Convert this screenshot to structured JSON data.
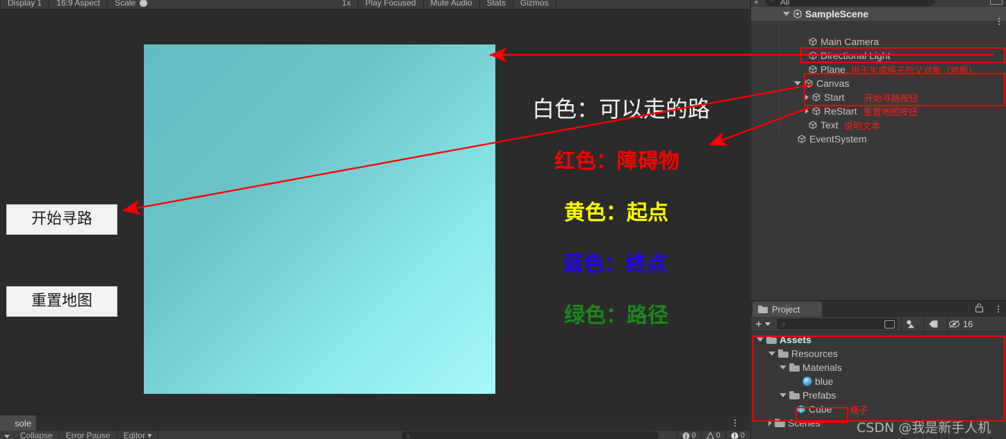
{
  "game_view": {
    "toolbar": {
      "display": "Display 1",
      "aspect": "16:9 Aspect",
      "scale_label": "Scale",
      "scale_value": "1x",
      "play_focused": "Play Focused",
      "mute_audio": "Mute Audio",
      "stats": "Stats",
      "gizmos": "Gizmos"
    },
    "buttons": {
      "start": "开始寻路",
      "reset": "重置地图"
    },
    "legend": [
      {
        "text": "白色：可以走的路",
        "color": "#f4f4f4"
      },
      {
        "text": "红色：障碍物",
        "color": "#ff0000"
      },
      {
        "text": "黄色：起点",
        "color": "#ffff00"
      },
      {
        "text": "蓝色：终点",
        "color": "#2200ff"
      },
      {
        "text": "绿色：路径",
        "color": "#1a8a1a"
      }
    ],
    "plane": {
      "color_top_left": "#62bcc2",
      "color_bottom_right": "#a6f8f7"
    }
  },
  "hierarchy": {
    "search_placeholder": "All",
    "scene": "SampleScene",
    "items": [
      {
        "label": "Main Camera",
        "note": ""
      },
      {
        "label": "Directional Light",
        "note": ""
      },
      {
        "label": "Plane",
        "note": "用于生成格子的父对象（地板）"
      },
      {
        "label": "Canvas",
        "note": ""
      },
      {
        "label": "Start",
        "note": "开始寻路按钮"
      },
      {
        "label": "ReStart",
        "note": "重置地图按钮"
      },
      {
        "label": "Text",
        "note": "说明文本"
      },
      {
        "label": "EventSystem",
        "note": ""
      }
    ]
  },
  "project": {
    "tab": "Project",
    "toolbar": {
      "add_label": "+",
      "search_placeholder": "",
      "visible_count": "16"
    },
    "tree": [
      {
        "label": "Assets",
        "note": ""
      },
      {
        "label": "Resources",
        "note": ""
      },
      {
        "label": "Materials",
        "note": ""
      },
      {
        "label": "blue",
        "note": ""
      },
      {
        "label": "Prefabs",
        "note": ""
      },
      {
        "label": "Cube",
        "note": "格子"
      },
      {
        "label": "Scenes",
        "note": ""
      }
    ]
  },
  "console": {
    "tab": "sole",
    "clear_label": "",
    "collapse": "Collapse",
    "error_pause": "Error Pause",
    "editor": "Editor",
    "search_placeholder": "",
    "counts": {
      "log": "0",
      "warning": "0",
      "error": "0"
    }
  },
  "annotation": {
    "watermark": "CSDN @我是新手人机",
    "accent_color": "#ff0000"
  }
}
